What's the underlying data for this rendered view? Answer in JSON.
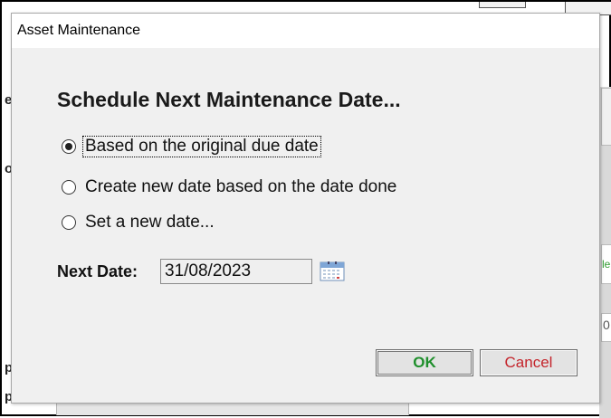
{
  "background": {
    "green_text": "le",
    "zero_text": "0",
    "left_glyphs": [
      "er",
      "or",
      "p",
      "p"
    ]
  },
  "dialog": {
    "title": "Asset Maintenance",
    "heading": "Schedule Next Maintenance Date...",
    "options": [
      {
        "label": "Based on the original due date",
        "checked": true
      },
      {
        "label": "Create new date based on the date done",
        "checked": false
      },
      {
        "label": "Set a new date...",
        "checked": false
      }
    ],
    "next_date_label": "Next Date:",
    "next_date_value": "31/08/2023",
    "calendar_icon": "calendar-icon",
    "ok_label": "OK",
    "cancel_label": "Cancel",
    "colors": {
      "ok": "#1f8f2c",
      "cancel": "#c4242b"
    }
  }
}
